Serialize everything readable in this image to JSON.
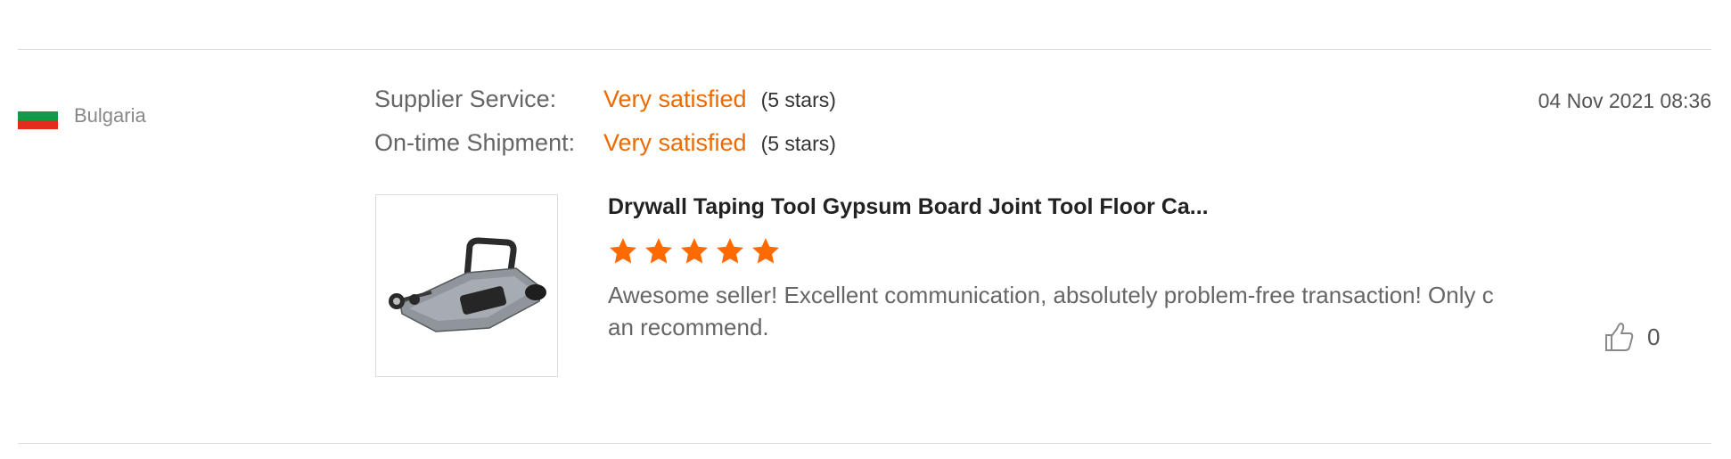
{
  "buyer": {
    "country": "Bulgaria",
    "flag_colors": [
      "#ffffff",
      "#129a4a",
      "#e32c1d"
    ]
  },
  "ratings": [
    {
      "label": "Supplier Service:",
      "value": "Very satisfied",
      "stars": "(5 stars)"
    },
    {
      "label": "On-time Shipment:",
      "value": "Very satisfied",
      "stars": "(5 stars)"
    }
  ],
  "date": "04 Nov 2021 08:36",
  "product": {
    "title": "Drywall Taping Tool Gypsum Board Joint Tool Floor Ca...",
    "thumbnail_icon": "drywall-taping-tool-image"
  },
  "review": {
    "star_rating": 5,
    "star_color": "#ff6a00",
    "comment": "Awesome seller! Excellent communication, absolutely problem-free transaction! Only can recommend."
  },
  "likes": {
    "icon": "thumbs-up-icon",
    "count": "0"
  },
  "colors": {
    "accent": "#ee6a00",
    "divider": "#dcdcdc"
  }
}
